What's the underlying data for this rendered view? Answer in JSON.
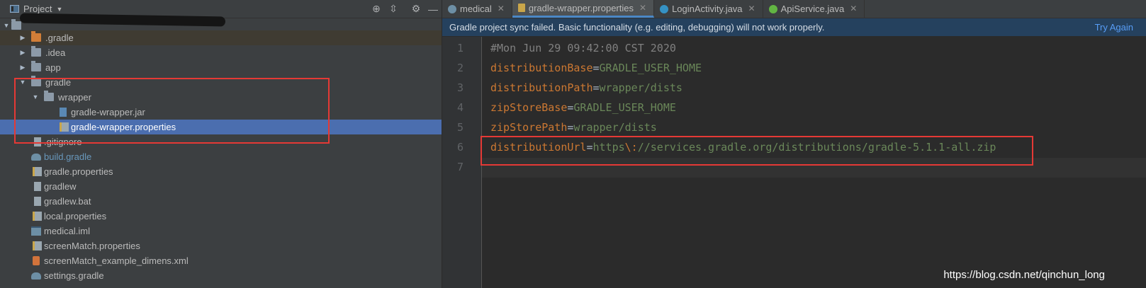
{
  "project_panel": {
    "title": "Project",
    "tool_icons": [
      "crosshair-icon",
      "collapse-icon",
      "gear-icon",
      "hide-icon"
    ]
  },
  "tree": [
    {
      "label": ".gradle",
      "icon": "folder-orange-icon"
    },
    {
      "label": ".idea",
      "icon": "folder-icon"
    },
    {
      "label": "app",
      "icon": "module-folder-icon"
    },
    {
      "label": "gradle",
      "icon": "folder-icon"
    },
    {
      "label": "wrapper",
      "icon": "folder-icon"
    },
    {
      "label": "gradle-wrapper.jar",
      "icon": "jar-file-icon"
    },
    {
      "label": "gradle-wrapper.properties",
      "icon": "properties-file-icon"
    },
    {
      "label": ".gitignore",
      "icon": "text-file-icon"
    },
    {
      "label": "build.gradle",
      "icon": "gradle-file-icon"
    },
    {
      "label": "gradle.properties",
      "icon": "properties-file-icon"
    },
    {
      "label": "gradlew",
      "icon": "text-file-icon"
    },
    {
      "label": "gradlew.bat",
      "icon": "text-file-icon"
    },
    {
      "label": "local.properties",
      "icon": "properties-file-icon"
    },
    {
      "label": "medical.iml",
      "icon": "iml-file-icon"
    },
    {
      "label": "screenMatch.properties",
      "icon": "properties-file-icon"
    },
    {
      "label": "screenMatch_example_dimens.xml",
      "icon": "xml-file-icon"
    },
    {
      "label": "settings.gradle",
      "icon": "gradle-file-icon"
    }
  ],
  "tabs": [
    {
      "label": "medical",
      "icon": "gradle-file-icon",
      "color": "#6d8fa5"
    },
    {
      "label": "gradle-wrapper.properties",
      "icon": "properties-file-icon",
      "color": "#c9a64a",
      "active": true
    },
    {
      "label": "LoginActivity.java",
      "icon": "class-icon",
      "color": "#3592c4"
    },
    {
      "label": "ApiService.java",
      "icon": "interface-icon",
      "color": "#62b543"
    }
  ],
  "banner": {
    "message": "Gradle project sync failed. Basic functionality (e.g. editing, debugging) will not work properly.",
    "action": "Try Again"
  },
  "editor": {
    "line_numbers": [
      "1",
      "2",
      "3",
      "4",
      "5",
      "6",
      "7"
    ],
    "comment": "#Mon Jun 29 09:42:00 CST 2020",
    "lines": [
      {
        "key": "distributionBase",
        "value": "GRADLE_USER_HOME"
      },
      {
        "key": "distributionPath",
        "value": "wrapper/dists"
      },
      {
        "key": "zipStoreBase",
        "value": "GRADLE_USER_HOME"
      },
      {
        "key": "zipStorePath",
        "value": "wrapper/dists"
      },
      {
        "key": "distributionUrl",
        "value_pre": "https",
        "escape": "\\:",
        "value_post": "//services.gradle.org/distributions/gradle-5.1.1-all.zip"
      }
    ],
    "equals": "="
  },
  "colors": {
    "accent": "#4b6eaf",
    "annotation": "#e53935",
    "key": "#cc7832",
    "value": "#6a8759"
  },
  "watermark": "https://blog.csdn.net/qinchun_long"
}
